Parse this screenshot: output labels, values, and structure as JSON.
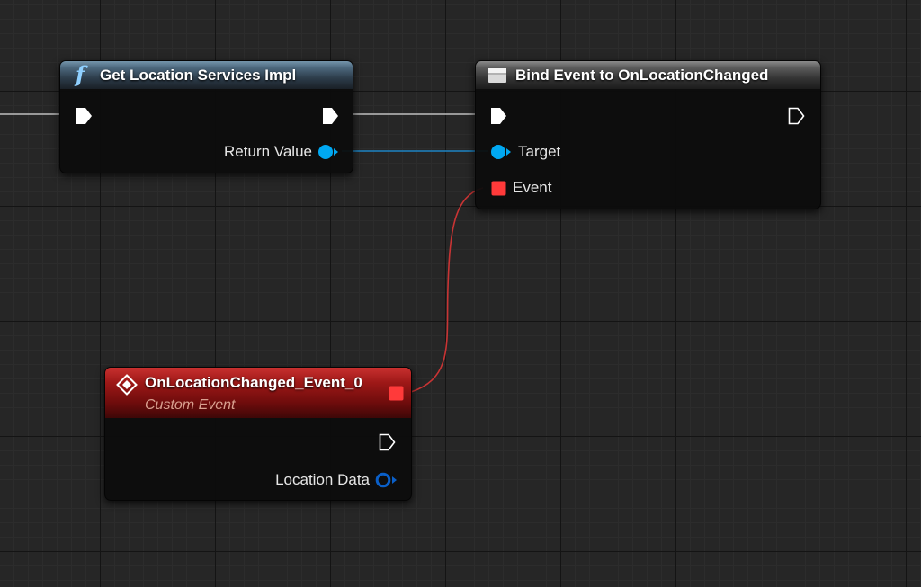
{
  "graph": {
    "colors": {
      "exec": "#ffffff",
      "object": "#00a8f2",
      "delegate": "#ff3a3a",
      "struct": "#0a5fc8"
    },
    "nodes": {
      "get_location": {
        "icon": "function-icon",
        "icon_glyph": "f",
        "title": "Get Location Services Impl",
        "pins": {
          "return_value": "Return Value"
        }
      },
      "bind_event": {
        "icon": "bind-event-icon",
        "title": "Bind Event to OnLocationChanged",
        "pins": {
          "target": "Target",
          "event": "Event"
        }
      },
      "custom_event": {
        "icon": "event-diamond-icon",
        "title": "OnLocationChanged_Event_0",
        "subtitle": "Custom Event",
        "pins": {
          "location_data": "Location Data"
        }
      }
    }
  }
}
